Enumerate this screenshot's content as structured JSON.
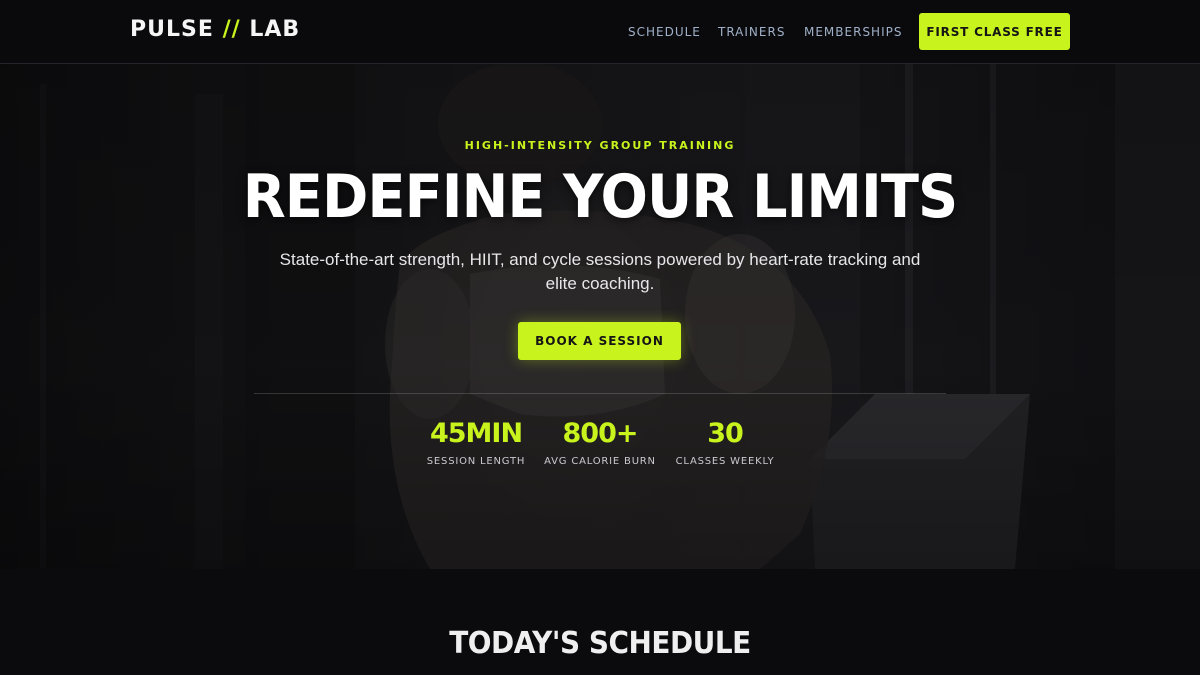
{
  "brand": {
    "logo_left": "PULSE",
    "logo_slash": "//",
    "logo_right": "LAB",
    "accent_color": "#c8f31d"
  },
  "nav": {
    "links": [
      "SCHEDULE",
      "TRAINERS",
      "MEMBERSHIPS"
    ],
    "cta_label": "FIRST CLASS FREE"
  },
  "hero": {
    "eyebrow": "HIGH-INTENSITY GROUP TRAINING",
    "headline": "REDEFINE YOUR LIMITS",
    "subhead": "State-of-the-art strength, HIIT, and cycle sessions powered by heart-rate tracking and elite coaching.",
    "cta_label": "BOOK A SESSION",
    "background_image": "athlete-training-photo"
  },
  "stats": [
    {
      "value": "45MIN",
      "label": "SESSION LENGTH"
    },
    {
      "value": "800+",
      "label": "AVG CALORIE BURN"
    },
    {
      "value": "30",
      "label": "CLASSES WEEKLY"
    }
  ],
  "schedule": {
    "title": "TODAY'S SCHEDULE"
  }
}
